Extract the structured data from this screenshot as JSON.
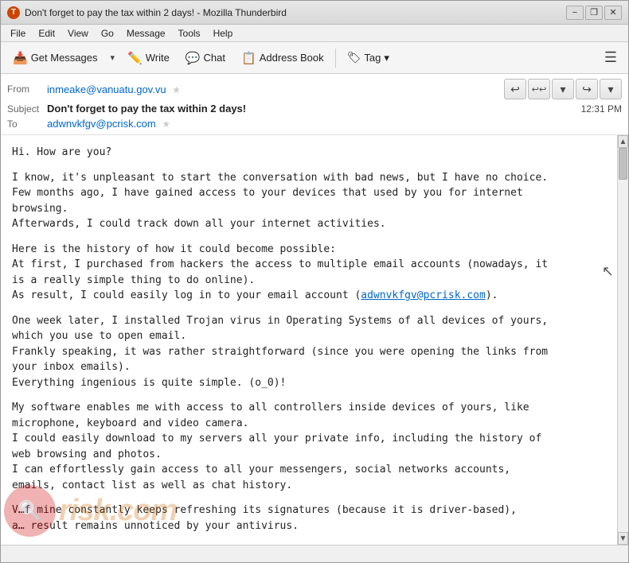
{
  "window": {
    "title": "Don't forget to pay the tax within 2 days! - Mozilla Thunderbird",
    "icon": "T"
  },
  "title_bar": {
    "minimize_label": "−",
    "restore_label": "❐",
    "close_label": "✕"
  },
  "menu": {
    "items": [
      "File",
      "Edit",
      "View",
      "Go",
      "Message",
      "Tools",
      "Help"
    ]
  },
  "toolbar": {
    "get_messages_label": "Get Messages",
    "write_label": "Write",
    "chat_label": "Chat",
    "address_book_label": "Address Book",
    "tag_label": "Tag",
    "tag_dropdown": "▾"
  },
  "message_header": {
    "from_label": "From",
    "from_value": "inmeake@vanuatu.gov.vu",
    "subject_label": "Subject",
    "subject_value": "Don't forget to pay the tax within 2 days!",
    "timestamp": "12:31 PM",
    "to_label": "To",
    "to_value": "adwnvkfgv@pcrisk.com"
  },
  "nav_buttons": {
    "reply_label": "↩",
    "reply_all_label": "↩↩",
    "dropdown_label": "▾",
    "forward_label": "↪",
    "more_label": "▾"
  },
  "message_body": {
    "paragraph1": "Hi. How are you?",
    "paragraph2": "I know, it's unpleasant to start the conversation with bad news, but I have no choice.\nFew months ago, I have gained access to your devices that used by you for internet\nbrowsing.\nAfterwards, I could track down all your internet activities.",
    "paragraph3": "Here is the history of how it could become possible:\nAt first, I purchased from hackers the access to multiple email accounts (nowadays, it\nis a really simple thing to do online).\nAs result, I could easily log in to your email account (adwnvkfgv@pcrisk.com).",
    "paragraph3_link_text": "adwnvkfgv@pcrisk.com",
    "paragraph4": "One week later, I installed Trojan virus in Operating Systems of all devices of yours,\nwhich you use to open email.\nFrankly speaking, it was rather straightforward (since you were opening the links from\nyour inbox emails).\nEverything ingenious is quite simple. (o_0)!",
    "paragraph5": "My software enables me with access to all controllers inside devices of yours, like\nmicrophone, keyboard and video camera.\nI could easily download to my servers all your private info, including the history of\nweb browsing and photos.\nI can effortlessly gain access to all your messengers, social networks accounts,\nemails, contact list as well as chat history.",
    "paragraph6": "V…f mine constantly keeps refreshing its signatures (because it is driver-based),\na… result remains unnoticed by your antivirus."
  },
  "status_bar": {
    "text": ""
  },
  "watermark": {
    "logo_text": "🔍",
    "site_text": "risk.com"
  }
}
